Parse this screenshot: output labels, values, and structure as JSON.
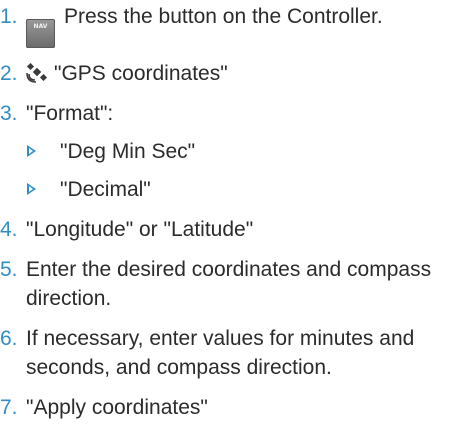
{
  "colors": {
    "accent": "#2f8ec4",
    "text": "#2b2b2b"
  },
  "steps": [
    {
      "num": "1.",
      "icon": "nav-button-icon",
      "icon_label": "NAV",
      "text": "Press the button on the Controller."
    },
    {
      "num": "2.",
      "icon": "gps-satellite-icon",
      "text": "\"GPS coordinates\""
    },
    {
      "num": "3.",
      "text": "\"Format\":",
      "sub": [
        "\"Deg Min Sec\"",
        "\"Decimal\""
      ]
    },
    {
      "num": "4.",
      "text": "\"Longitude\" or \"Latitude\""
    },
    {
      "num": "5.",
      "text": "Enter the desired coordinates and compass direction."
    },
    {
      "num": "6.",
      "text": "If necessary, enter values for minutes and seconds, and compass direction."
    },
    {
      "num": "7.",
      "text": "\"Apply coordinates\""
    }
  ]
}
